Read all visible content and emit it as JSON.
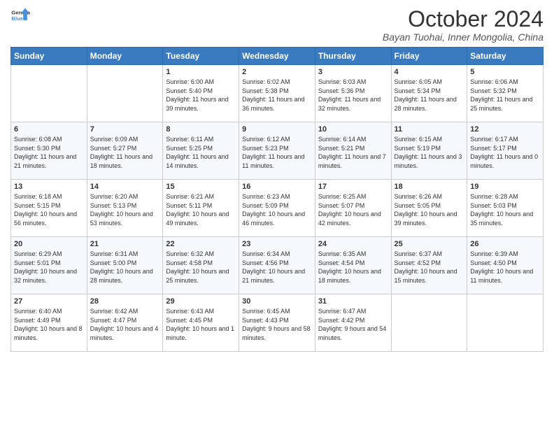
{
  "header": {
    "logo_general": "General",
    "logo_blue": "Blue",
    "month_title": "October 2024",
    "location": "Bayan Tuohai, Inner Mongolia, China"
  },
  "days_of_week": [
    "Sunday",
    "Monday",
    "Tuesday",
    "Wednesday",
    "Thursday",
    "Friday",
    "Saturday"
  ],
  "weeks": [
    [
      {
        "day": "",
        "info": ""
      },
      {
        "day": "",
        "info": ""
      },
      {
        "day": "1",
        "info": "Sunrise: 6:00 AM\nSunset: 5:40 PM\nDaylight: 11 hours and 39 minutes."
      },
      {
        "day": "2",
        "info": "Sunrise: 6:02 AM\nSunset: 5:38 PM\nDaylight: 11 hours and 36 minutes."
      },
      {
        "day": "3",
        "info": "Sunrise: 6:03 AM\nSunset: 5:36 PM\nDaylight: 11 hours and 32 minutes."
      },
      {
        "day": "4",
        "info": "Sunrise: 6:05 AM\nSunset: 5:34 PM\nDaylight: 11 hours and 28 minutes."
      },
      {
        "day": "5",
        "info": "Sunrise: 6:06 AM\nSunset: 5:32 PM\nDaylight: 11 hours and 25 minutes."
      }
    ],
    [
      {
        "day": "6",
        "info": "Sunrise: 6:08 AM\nSunset: 5:30 PM\nDaylight: 11 hours and 21 minutes."
      },
      {
        "day": "7",
        "info": "Sunrise: 6:09 AM\nSunset: 5:27 PM\nDaylight: 11 hours and 18 minutes."
      },
      {
        "day": "8",
        "info": "Sunrise: 6:11 AM\nSunset: 5:25 PM\nDaylight: 11 hours and 14 minutes."
      },
      {
        "day": "9",
        "info": "Sunrise: 6:12 AM\nSunset: 5:23 PM\nDaylight: 11 hours and 11 minutes."
      },
      {
        "day": "10",
        "info": "Sunrise: 6:14 AM\nSunset: 5:21 PM\nDaylight: 11 hours and 7 minutes."
      },
      {
        "day": "11",
        "info": "Sunrise: 6:15 AM\nSunset: 5:19 PM\nDaylight: 11 hours and 3 minutes."
      },
      {
        "day": "12",
        "info": "Sunrise: 6:17 AM\nSunset: 5:17 PM\nDaylight: 11 hours and 0 minutes."
      }
    ],
    [
      {
        "day": "13",
        "info": "Sunrise: 6:18 AM\nSunset: 5:15 PM\nDaylight: 10 hours and 56 minutes."
      },
      {
        "day": "14",
        "info": "Sunrise: 6:20 AM\nSunset: 5:13 PM\nDaylight: 10 hours and 53 minutes."
      },
      {
        "day": "15",
        "info": "Sunrise: 6:21 AM\nSunset: 5:11 PM\nDaylight: 10 hours and 49 minutes."
      },
      {
        "day": "16",
        "info": "Sunrise: 6:23 AM\nSunset: 5:09 PM\nDaylight: 10 hours and 46 minutes."
      },
      {
        "day": "17",
        "info": "Sunrise: 6:25 AM\nSunset: 5:07 PM\nDaylight: 10 hours and 42 minutes."
      },
      {
        "day": "18",
        "info": "Sunrise: 6:26 AM\nSunset: 5:05 PM\nDaylight: 10 hours and 39 minutes."
      },
      {
        "day": "19",
        "info": "Sunrise: 6:28 AM\nSunset: 5:03 PM\nDaylight: 10 hours and 35 minutes."
      }
    ],
    [
      {
        "day": "20",
        "info": "Sunrise: 6:29 AM\nSunset: 5:01 PM\nDaylight: 10 hours and 32 minutes."
      },
      {
        "day": "21",
        "info": "Sunrise: 6:31 AM\nSunset: 5:00 PM\nDaylight: 10 hours and 28 minutes."
      },
      {
        "day": "22",
        "info": "Sunrise: 6:32 AM\nSunset: 4:58 PM\nDaylight: 10 hours and 25 minutes."
      },
      {
        "day": "23",
        "info": "Sunrise: 6:34 AM\nSunset: 4:56 PM\nDaylight: 10 hours and 21 minutes."
      },
      {
        "day": "24",
        "info": "Sunrise: 6:35 AM\nSunset: 4:54 PM\nDaylight: 10 hours and 18 minutes."
      },
      {
        "day": "25",
        "info": "Sunrise: 6:37 AM\nSunset: 4:52 PM\nDaylight: 10 hours and 15 minutes."
      },
      {
        "day": "26",
        "info": "Sunrise: 6:39 AM\nSunset: 4:50 PM\nDaylight: 10 hours and 11 minutes."
      }
    ],
    [
      {
        "day": "27",
        "info": "Sunrise: 6:40 AM\nSunset: 4:49 PM\nDaylight: 10 hours and 8 minutes."
      },
      {
        "day": "28",
        "info": "Sunrise: 6:42 AM\nSunset: 4:47 PM\nDaylight: 10 hours and 4 minutes."
      },
      {
        "day": "29",
        "info": "Sunrise: 6:43 AM\nSunset: 4:45 PM\nDaylight: 10 hours and 1 minute."
      },
      {
        "day": "30",
        "info": "Sunrise: 6:45 AM\nSunset: 4:43 PM\nDaylight: 9 hours and 58 minutes."
      },
      {
        "day": "31",
        "info": "Sunrise: 6:47 AM\nSunset: 4:42 PM\nDaylight: 9 hours and 54 minutes."
      },
      {
        "day": "",
        "info": ""
      },
      {
        "day": "",
        "info": ""
      }
    ]
  ]
}
